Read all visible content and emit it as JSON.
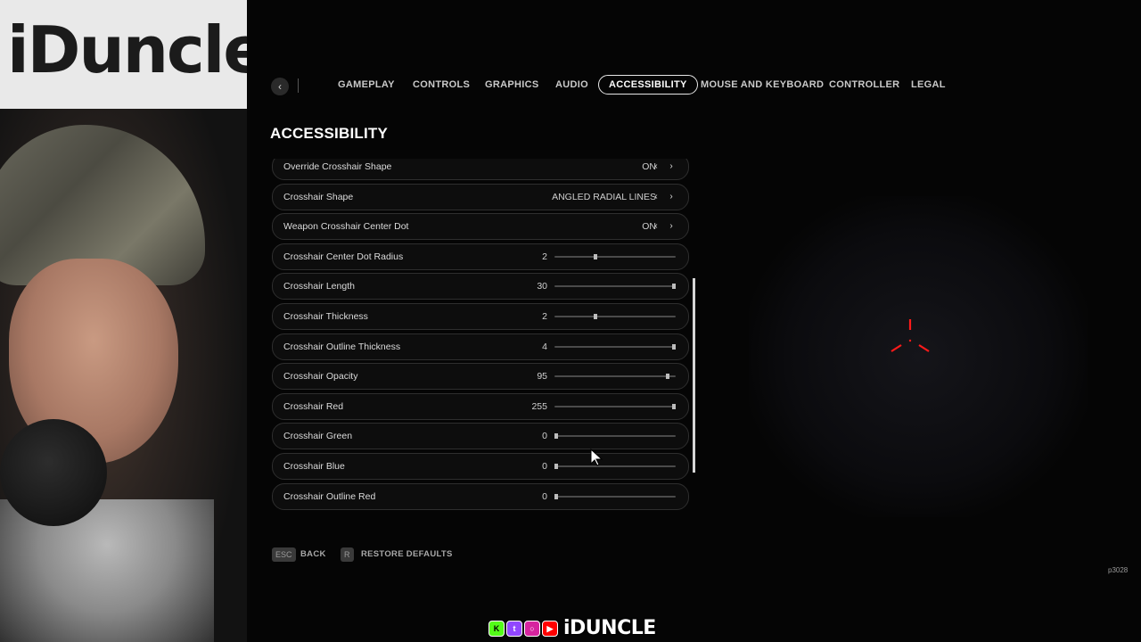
{
  "webcam": {
    "sign_text": "iDuncle"
  },
  "nav": {
    "back_icon": "chevron-left-icon",
    "tabs": [
      {
        "label": "GAMEPLAY",
        "active": false
      },
      {
        "label": "CONTROLS",
        "active": false
      },
      {
        "label": "GRAPHICS",
        "active": false
      },
      {
        "label": "AUDIO",
        "active": false
      },
      {
        "label": "ACCESSIBILITY",
        "active": true
      },
      {
        "label": "MOUSE AND KEYBOARD",
        "active": false
      },
      {
        "label": "CONTROLLER",
        "active": false
      },
      {
        "label": "LEGAL",
        "active": false
      }
    ]
  },
  "page": {
    "title": "ACCESSIBILITY"
  },
  "settings": [
    {
      "label": "Override Crosshair Shape",
      "type": "toggle",
      "value": "ON"
    },
    {
      "label": "Crosshair Shape",
      "type": "toggle",
      "value": "ANGLED RADIAL LINES"
    },
    {
      "label": "Weapon Crosshair Center Dot",
      "type": "toggle",
      "value": "ON"
    },
    {
      "label": "Crosshair Center Dot Radius",
      "type": "slider",
      "value": "2",
      "fraction": 0.33
    },
    {
      "label": "Crosshair Length",
      "type": "slider",
      "value": "30",
      "fraction": 1.0
    },
    {
      "label": "Crosshair Thickness",
      "type": "slider",
      "value": "2",
      "fraction": 0.33
    },
    {
      "label": "Crosshair Outline Thickness",
      "type": "slider",
      "value": "4",
      "fraction": 1.0
    },
    {
      "label": "Crosshair Opacity",
      "type": "slider",
      "value": "95",
      "fraction": 0.95
    },
    {
      "label": "Crosshair Red",
      "type": "slider",
      "value": "255",
      "fraction": 1.0
    },
    {
      "label": "Crosshair Green",
      "type": "slider",
      "value": "0",
      "fraction": 0.0
    },
    {
      "label": "Crosshair Blue",
      "type": "slider",
      "value": "0",
      "fraction": 0.0
    },
    {
      "label": "Crosshair Outline Red",
      "type": "slider",
      "value": "0",
      "fraction": 0.0
    }
  ],
  "footer": {
    "back_key": "ESC",
    "back_label": "BACK",
    "restore_key": "R",
    "restore_label": "RESTORE DEFAULTS"
  },
  "preview": {
    "crosshair_color": "#ff1a1a"
  },
  "watermark": "p3028",
  "social": {
    "icons": [
      "kick-icon",
      "twitch-icon",
      "instagram-icon",
      "youtube-icon"
    ],
    "name": "iDUNCLE"
  }
}
